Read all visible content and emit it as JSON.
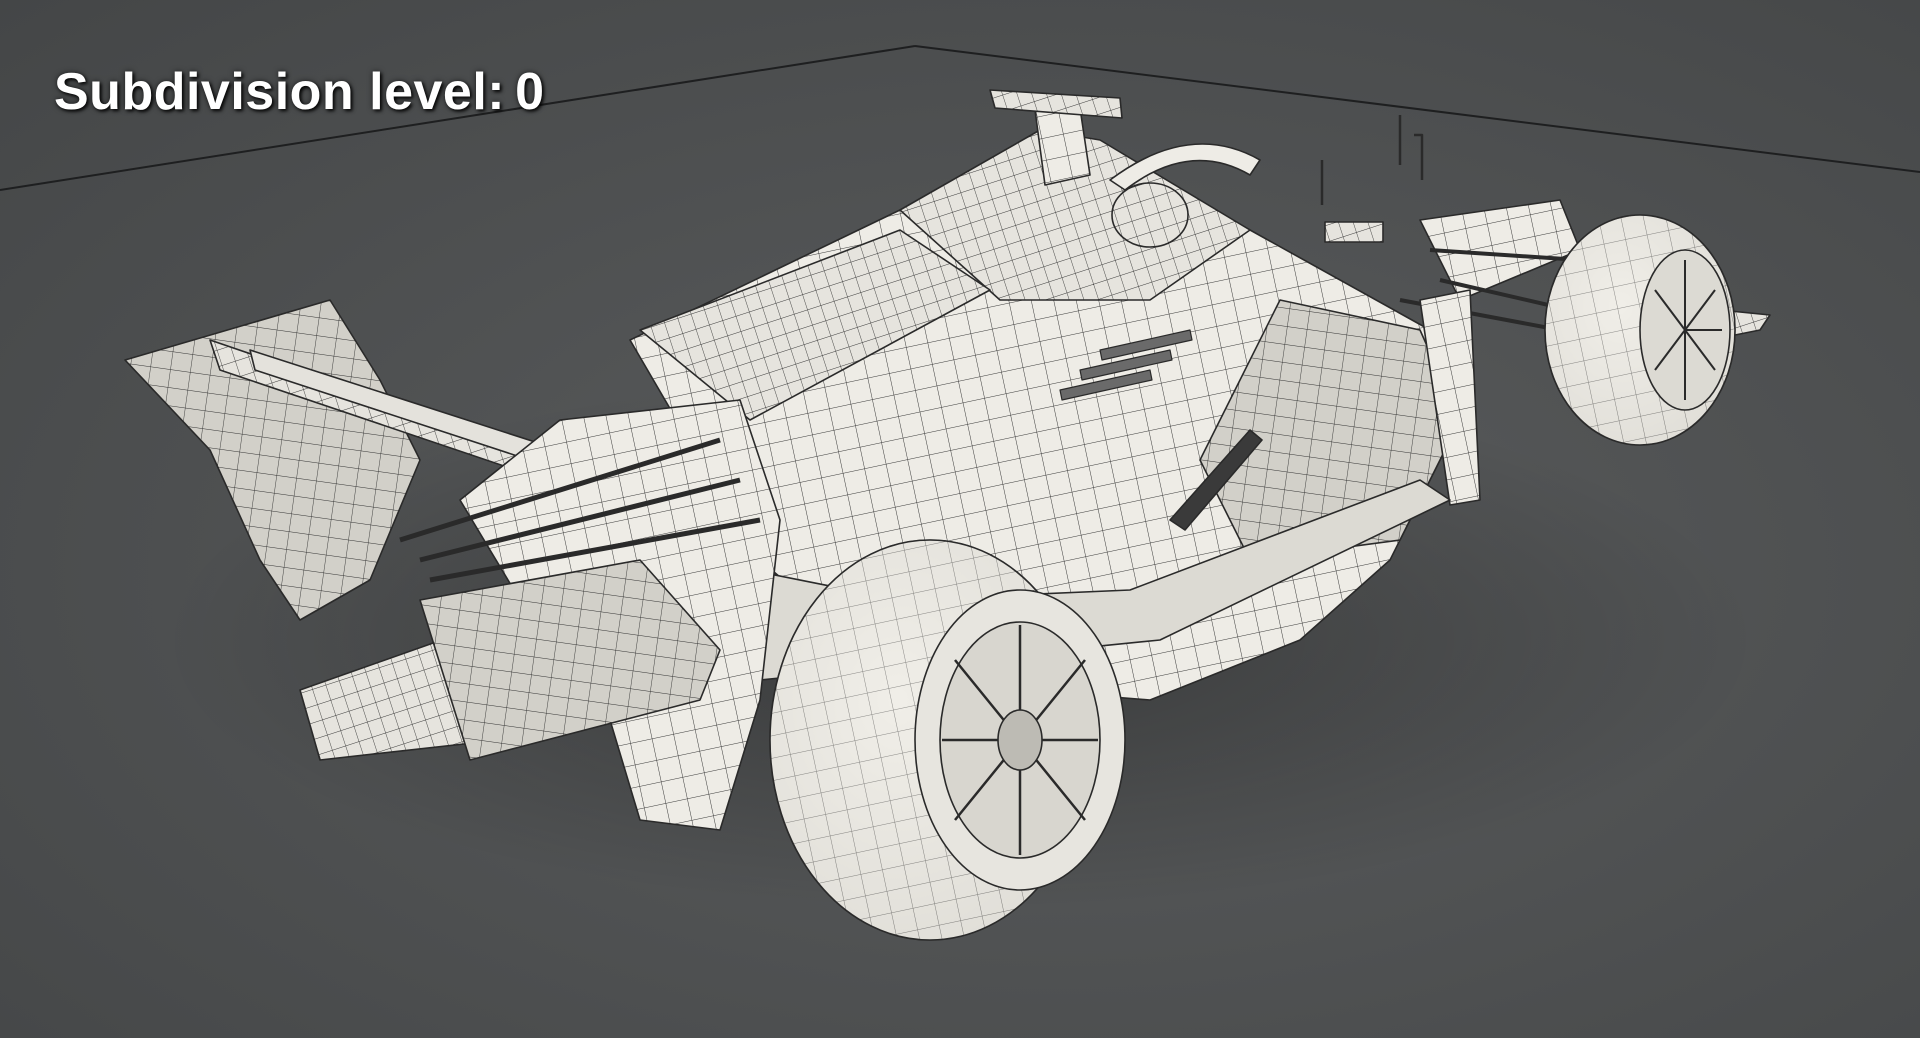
{
  "overlay": {
    "label": "Subdivision level:",
    "value": "0"
  },
  "colors": {
    "background": "#505253",
    "ground_line": "#1e1f20",
    "mesh_fill": "#eeece6",
    "mesh_shadow": "#bdbbb4",
    "wire": "#2a2a2a",
    "label_text": "#ffffff"
  },
  "scene": {
    "object": "formula-car-wireframe",
    "shading": "solid-with-wireframe",
    "ground_plane": true
  }
}
